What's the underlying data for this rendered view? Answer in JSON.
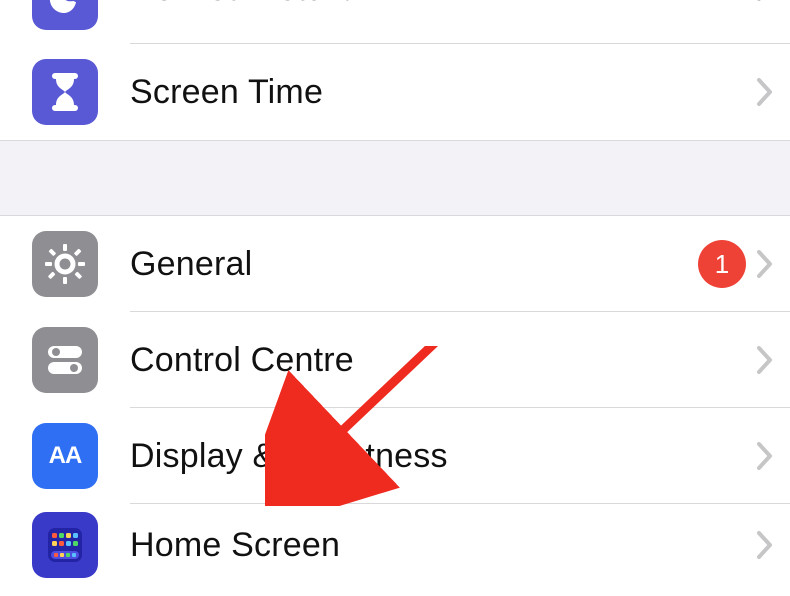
{
  "group1": {
    "items": [
      {
        "label": "Do Not Disturb"
      },
      {
        "label": "Screen Time"
      }
    ]
  },
  "group2": {
    "items": [
      {
        "label": "General",
        "badge": "1"
      },
      {
        "label": "Control Centre"
      },
      {
        "label": "Display & Brightness"
      },
      {
        "label": "Home Screen"
      }
    ]
  }
}
